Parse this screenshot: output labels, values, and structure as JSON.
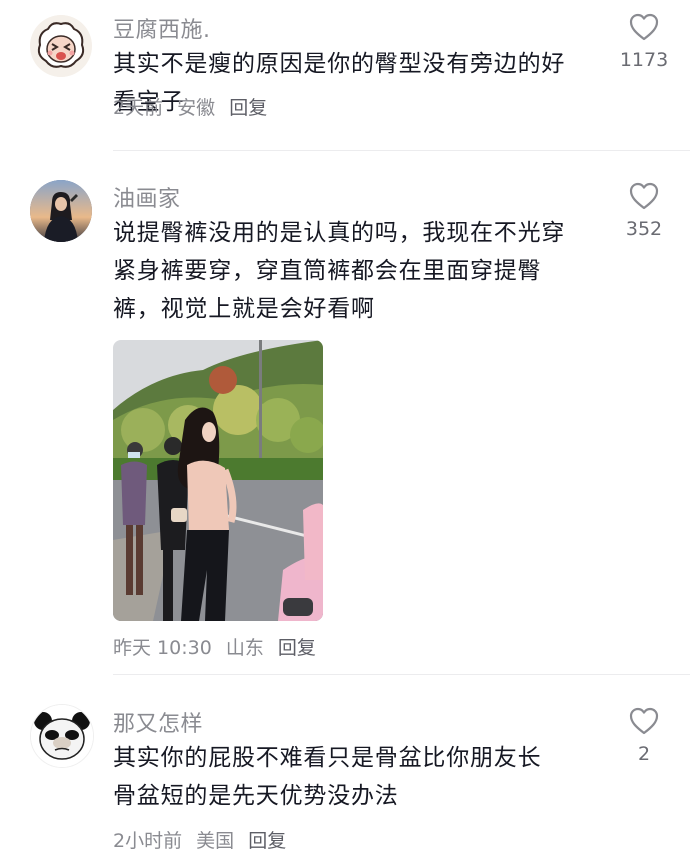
{
  "comments": [
    {
      "username": "豆腐西施.",
      "avatar_icon": "cartoon-sheep-avatar",
      "text_lines": [
        "其实不是瘦的原因是你的臀型没有旁边的好",
        "看宝子"
      ],
      "time": "2天前",
      "location": "安徽",
      "reply_label": "回复",
      "likes": "1173"
    },
    {
      "username": "油画家",
      "avatar_icon": "photo-avatar-woman",
      "text_lines": [
        "说提臀裤没用的是认真的吗，我现在不光穿",
        "紧身裤要穿，穿直筒裤都会在里面穿提臀",
        "裤，视觉上就是会好看啊"
      ],
      "image_icon": "street-photo",
      "time": "昨天 10:30",
      "location": "山东",
      "reply_label": "回复",
      "likes": "352"
    },
    {
      "username": "那又怎样",
      "avatar_icon": "panda-meme-avatar",
      "text_lines": [
        "其实你的屁股不难看只是骨盆比你朋友长",
        "骨盆短的是先天优势没办法"
      ],
      "time": "2小时前",
      "location": "美国",
      "reply_label": "回复",
      "likes": "2"
    }
  ],
  "colors": {
    "text": "#161823",
    "secondary": "#8a8b91",
    "divider": "#ececee",
    "icon": "#8a8b91"
  }
}
